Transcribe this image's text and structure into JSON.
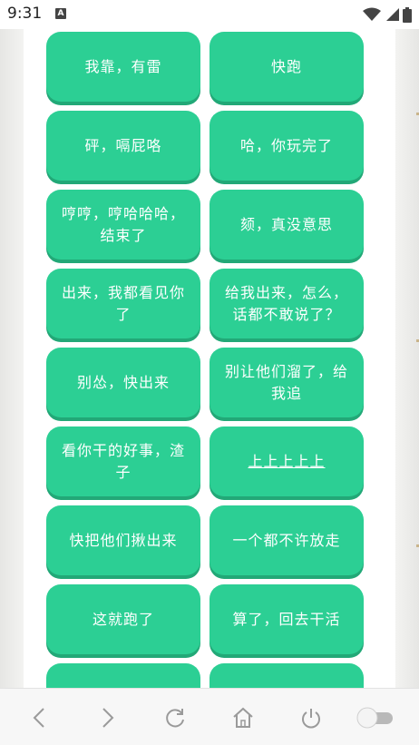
{
  "status_bar": {
    "time": "9:31",
    "notification_glyph": "A",
    "icons": [
      "wifi-icon",
      "signal-icon",
      "battery-icon"
    ]
  },
  "buttons": [
    {
      "label": "我靠，有雷"
    },
    {
      "label": "快跑"
    },
    {
      "label": "砰，嗝屁咯"
    },
    {
      "label": "哈，你玩完了"
    },
    {
      "label": "哼哼，哼哈哈哈，结束了"
    },
    {
      "label": "颏，真没意思"
    },
    {
      "label": "出来，我都看见你了"
    },
    {
      "label": "给我出来，怎么，话都不敢说了？"
    },
    {
      "label": "别怂，快出来"
    },
    {
      "label": "别让他们溜了，给我追"
    },
    {
      "label": "看你干的好事，渣子"
    },
    {
      "label": "上上上上上",
      "underlined": true
    },
    {
      "label": "快把他们揪出来"
    },
    {
      "label": "一个都不许放走"
    },
    {
      "label": "这就跑了"
    },
    {
      "label": "算了，回去干活"
    },
    {
      "label": ""
    },
    {
      "label": ""
    }
  ],
  "bottom_nav": {
    "items": [
      "back-icon",
      "forward-icon",
      "refresh-icon",
      "home-icon",
      "power-icon",
      "toggle-switch"
    ]
  },
  "colors": {
    "button": "#2ccf94",
    "button_shadow": "#22a877",
    "icon": "#9a9a9a"
  }
}
